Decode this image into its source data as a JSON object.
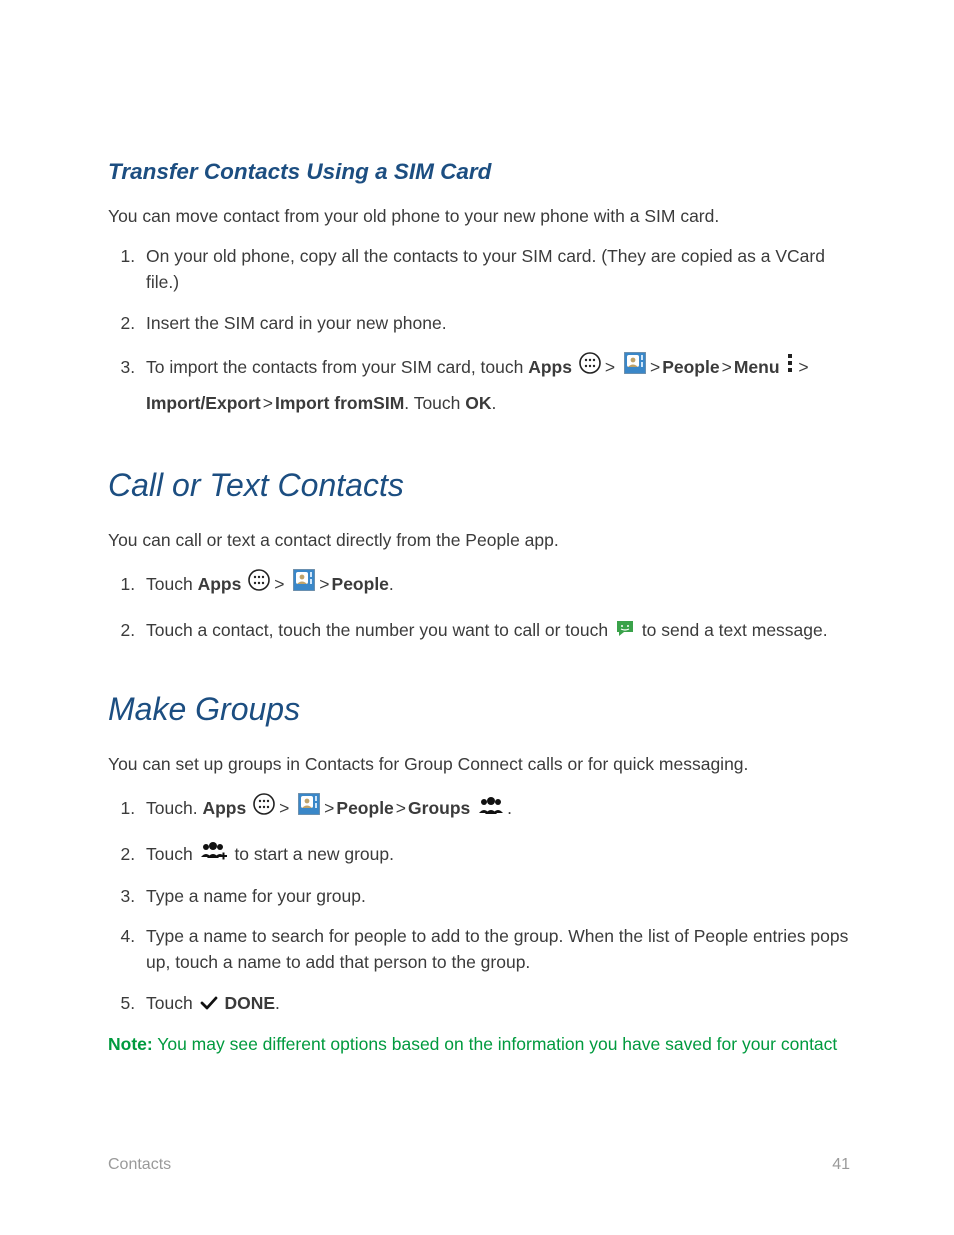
{
  "section1": {
    "heading": "Transfer Contacts Using a SIM Card",
    "intro": "You can move contact from your old phone to your new phone with a SIM card.",
    "li1": "On your old phone, copy all the contacts to your SIM card. (They are copied as a VCard file.)",
    "li2": "Insert the SIM card in your new phone.",
    "li3": {
      "t1": "To import the contacts from your SIM card, touch ",
      "apps": "Apps",
      "gt1": " > ",
      "gt2": " > ",
      "people": "People",
      "gt3": " > ",
      "menu": "Menu",
      "gt4": " > ",
      "impexp": "Import/Export",
      "gt5": " > ",
      "importsim": "Import fromSIM",
      "touch": ". Touch ",
      "ok": "OK",
      "dot": "."
    }
  },
  "section2": {
    "heading": "Call or Text Contacts",
    "intro": "You can call or text a contact directly from the People app.",
    "li1": {
      "t1": "Touch ",
      "apps": "Apps",
      "gt1": " > ",
      "gt2": " > ",
      "people": "People",
      "dot": "."
    },
    "li2": {
      "t1": "Touch a contact, touch the number you want to call or touch ",
      "t2": " to send a text message."
    }
  },
  "section3": {
    "heading": "Make Groups",
    "intro": "You can set up groups in Contacts for Group Connect calls or for quick messaging.",
    "li1": {
      "t1": "Touch. ",
      "apps": "Apps",
      "gt1": " > ",
      "gt2": " > ",
      "people": "People",
      "gt3": " > ",
      "groups": "Groups",
      "dot": "."
    },
    "li2": {
      "t1": "Touch ",
      "t2": " to start a new group."
    },
    "li3": "Type a name for your group.",
    "li4": "Type a name to search for people to add to the group. When the list of People entries pops up, touch a name to add that person to the group.",
    "li5": {
      "t1": "Touch ",
      "done": "DONE",
      "dot": "."
    }
  },
  "note": {
    "label": "Note:",
    "text": " You may see different options based on the information you have saved for your contact"
  },
  "footer": {
    "section": "Contacts",
    "page": "41"
  }
}
